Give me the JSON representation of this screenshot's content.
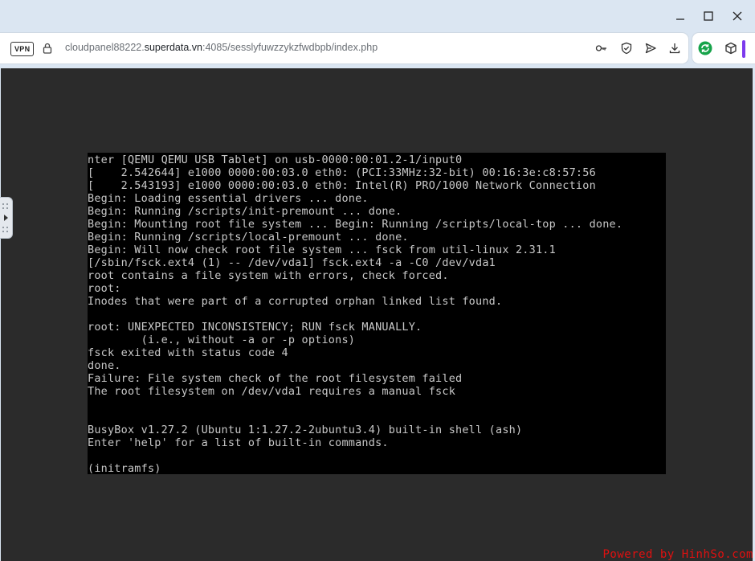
{
  "window": {
    "minimize_label": "—",
    "maximize_label": "☐",
    "close_label": "✕"
  },
  "addressbar": {
    "vpn_badge": "VPN",
    "url_prefix": "cloudpanel88222.",
    "url_host": "superdata.vn",
    "url_suffix": ":4085/sesslyfuwzzykzfwdbpb/index.php",
    "icons": [
      "key-icon",
      "shield-check-icon",
      "send-icon",
      "download-icon"
    ]
  },
  "extensions": {
    "icons": [
      "sync-extension-icon",
      "cube-extension-icon"
    ],
    "accent_color": "#7c3aed",
    "sync_color": "#16a34a"
  },
  "console": {
    "lines": [
      "nter [QEMU QEMU USB Tablet] on usb-0000:00:01.2-1/input0",
      "[    2.542644] e1000 0000:00:03.0 eth0: (PCI:33MHz:32-bit) 00:16:3e:c8:57:56",
      "[    2.543193] e1000 0000:00:03.0 eth0: Intel(R) PRO/1000 Network Connection",
      "Begin: Loading essential drivers ... done.",
      "Begin: Running /scripts/init-premount ... done.",
      "Begin: Mounting root file system ... Begin: Running /scripts/local-top ... done.",
      "Begin: Running /scripts/local-premount ... done.",
      "Begin: Will now check root file system ... fsck from util-linux 2.31.1",
      "[/sbin/fsck.ext4 (1) -- /dev/vda1] fsck.ext4 -a -C0 /dev/vda1",
      "root contains a file system with errors, check forced.",
      "root:",
      "Inodes that were part of a corrupted orphan linked list found.",
      "",
      "root: UNEXPECTED INCONSISTENCY; RUN fsck MANUALLY.",
      "        (i.e., without -a or -p options)",
      "fsck exited with status code 4",
      "done.",
      "Failure: File system check of the root filesystem failed",
      "The root filesystem on /dev/vda1 requires a manual fsck",
      "",
      "",
      "BusyBox v1.27.2 (Ubuntu 1:1.27.2-2ubuntu3.4) built-in shell (ash)",
      "Enter 'help' for a list of built-in commands.",
      "",
      "(initramfs)"
    ]
  },
  "watermark": "Powered by HinhSo.com"
}
